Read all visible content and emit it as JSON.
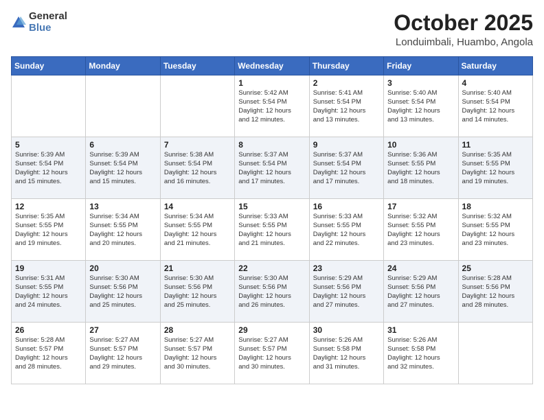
{
  "header": {
    "logo_general": "General",
    "logo_blue": "Blue",
    "month": "October 2025",
    "location": "Londuimbali, Huambo, Angola"
  },
  "days_of_week": [
    "Sunday",
    "Monday",
    "Tuesday",
    "Wednesday",
    "Thursday",
    "Friday",
    "Saturday"
  ],
  "weeks": [
    [
      {
        "day": "",
        "info": ""
      },
      {
        "day": "",
        "info": ""
      },
      {
        "day": "",
        "info": ""
      },
      {
        "day": "1",
        "info": "Sunrise: 5:42 AM\nSunset: 5:54 PM\nDaylight: 12 hours\nand 12 minutes."
      },
      {
        "day": "2",
        "info": "Sunrise: 5:41 AM\nSunset: 5:54 PM\nDaylight: 12 hours\nand 13 minutes."
      },
      {
        "day": "3",
        "info": "Sunrise: 5:40 AM\nSunset: 5:54 PM\nDaylight: 12 hours\nand 13 minutes."
      },
      {
        "day": "4",
        "info": "Sunrise: 5:40 AM\nSunset: 5:54 PM\nDaylight: 12 hours\nand 14 minutes."
      }
    ],
    [
      {
        "day": "5",
        "info": "Sunrise: 5:39 AM\nSunset: 5:54 PM\nDaylight: 12 hours\nand 15 minutes."
      },
      {
        "day": "6",
        "info": "Sunrise: 5:39 AM\nSunset: 5:54 PM\nDaylight: 12 hours\nand 15 minutes."
      },
      {
        "day": "7",
        "info": "Sunrise: 5:38 AM\nSunset: 5:54 PM\nDaylight: 12 hours\nand 16 minutes."
      },
      {
        "day": "8",
        "info": "Sunrise: 5:37 AM\nSunset: 5:54 PM\nDaylight: 12 hours\nand 17 minutes."
      },
      {
        "day": "9",
        "info": "Sunrise: 5:37 AM\nSunset: 5:54 PM\nDaylight: 12 hours\nand 17 minutes."
      },
      {
        "day": "10",
        "info": "Sunrise: 5:36 AM\nSunset: 5:55 PM\nDaylight: 12 hours\nand 18 minutes."
      },
      {
        "day": "11",
        "info": "Sunrise: 5:35 AM\nSunset: 5:55 PM\nDaylight: 12 hours\nand 19 minutes."
      }
    ],
    [
      {
        "day": "12",
        "info": "Sunrise: 5:35 AM\nSunset: 5:55 PM\nDaylight: 12 hours\nand 19 minutes."
      },
      {
        "day": "13",
        "info": "Sunrise: 5:34 AM\nSunset: 5:55 PM\nDaylight: 12 hours\nand 20 minutes."
      },
      {
        "day": "14",
        "info": "Sunrise: 5:34 AM\nSunset: 5:55 PM\nDaylight: 12 hours\nand 21 minutes."
      },
      {
        "day": "15",
        "info": "Sunrise: 5:33 AM\nSunset: 5:55 PM\nDaylight: 12 hours\nand 21 minutes."
      },
      {
        "day": "16",
        "info": "Sunrise: 5:33 AM\nSunset: 5:55 PM\nDaylight: 12 hours\nand 22 minutes."
      },
      {
        "day": "17",
        "info": "Sunrise: 5:32 AM\nSunset: 5:55 PM\nDaylight: 12 hours\nand 23 minutes."
      },
      {
        "day": "18",
        "info": "Sunrise: 5:32 AM\nSunset: 5:55 PM\nDaylight: 12 hours\nand 23 minutes."
      }
    ],
    [
      {
        "day": "19",
        "info": "Sunrise: 5:31 AM\nSunset: 5:55 PM\nDaylight: 12 hours\nand 24 minutes."
      },
      {
        "day": "20",
        "info": "Sunrise: 5:30 AM\nSunset: 5:56 PM\nDaylight: 12 hours\nand 25 minutes."
      },
      {
        "day": "21",
        "info": "Sunrise: 5:30 AM\nSunset: 5:56 PM\nDaylight: 12 hours\nand 25 minutes."
      },
      {
        "day": "22",
        "info": "Sunrise: 5:30 AM\nSunset: 5:56 PM\nDaylight: 12 hours\nand 26 minutes."
      },
      {
        "day": "23",
        "info": "Sunrise: 5:29 AM\nSunset: 5:56 PM\nDaylight: 12 hours\nand 27 minutes."
      },
      {
        "day": "24",
        "info": "Sunrise: 5:29 AM\nSunset: 5:56 PM\nDaylight: 12 hours\nand 27 minutes."
      },
      {
        "day": "25",
        "info": "Sunrise: 5:28 AM\nSunset: 5:56 PM\nDaylight: 12 hours\nand 28 minutes."
      }
    ],
    [
      {
        "day": "26",
        "info": "Sunrise: 5:28 AM\nSunset: 5:57 PM\nDaylight: 12 hours\nand 28 minutes."
      },
      {
        "day": "27",
        "info": "Sunrise: 5:27 AM\nSunset: 5:57 PM\nDaylight: 12 hours\nand 29 minutes."
      },
      {
        "day": "28",
        "info": "Sunrise: 5:27 AM\nSunset: 5:57 PM\nDaylight: 12 hours\nand 30 minutes."
      },
      {
        "day": "29",
        "info": "Sunrise: 5:27 AM\nSunset: 5:57 PM\nDaylight: 12 hours\nand 30 minutes."
      },
      {
        "day": "30",
        "info": "Sunrise: 5:26 AM\nSunset: 5:58 PM\nDaylight: 12 hours\nand 31 minutes."
      },
      {
        "day": "31",
        "info": "Sunrise: 5:26 AM\nSunset: 5:58 PM\nDaylight: 12 hours\nand 32 minutes."
      },
      {
        "day": "",
        "info": ""
      }
    ]
  ]
}
